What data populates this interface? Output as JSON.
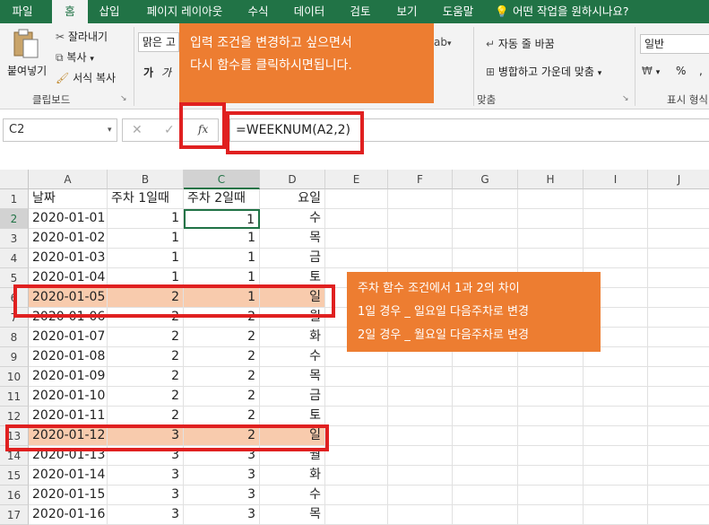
{
  "ribbon_tabs": [
    {
      "label": "파일"
    },
    {
      "label": "홈"
    },
    {
      "label": "삽입"
    },
    {
      "label": "페이지 레이아웃"
    },
    {
      "label": "수식"
    },
    {
      "label": "데이터"
    },
    {
      "label": "검토"
    },
    {
      "label": "보기"
    },
    {
      "label": "도움말"
    },
    {
      "label": "어떤 작업을 원하시나요?"
    }
  ],
  "clipboard": {
    "paste": "붙여넣기",
    "cut": "잘라내기",
    "copy": "복사",
    "format_painter": "서식 복사",
    "group": "클립보드"
  },
  "font": {
    "name": "맑은 고",
    "bold": "가",
    "italic": "가"
  },
  "alignment": {
    "wrap": "자동 줄 바꿈",
    "merge": "병합하고 가운데 맞춤",
    "group": "맞춤"
  },
  "number": {
    "format": "일반",
    "percent": "%",
    "comma": ",",
    "group": "표시 형식"
  },
  "formula_bar": {
    "name_box": "C2",
    "cancel": "✕",
    "enter": "✓",
    "fx": "fx",
    "formula": "=WEEKNUM(A2,2)"
  },
  "columns": [
    "A",
    "B",
    "C",
    "D",
    "E",
    "F",
    "G",
    "H",
    "I",
    "J"
  ],
  "rows": [
    {
      "n": "1",
      "a": "날짜",
      "b": "주차 1일때",
      "c": "주차 2일때",
      "d": "요일"
    },
    {
      "n": "2",
      "a": "2020-01-01",
      "b": "1",
      "c": "1",
      "d": "수"
    },
    {
      "n": "3",
      "a": "2020-01-02",
      "b": "1",
      "c": "1",
      "d": "목"
    },
    {
      "n": "4",
      "a": "2020-01-03",
      "b": "1",
      "c": "1",
      "d": "금"
    },
    {
      "n": "5",
      "a": "2020-01-04",
      "b": "1",
      "c": "1",
      "d": "토"
    },
    {
      "n": "6",
      "a": "2020-01-05",
      "b": "2",
      "c": "1",
      "d": "일"
    },
    {
      "n": "7",
      "a": "2020-01-06",
      "b": "2",
      "c": "2",
      "d": "월"
    },
    {
      "n": "8",
      "a": "2020-01-07",
      "b": "2",
      "c": "2",
      "d": "화"
    },
    {
      "n": "9",
      "a": "2020-01-08",
      "b": "2",
      "c": "2",
      "d": "수"
    },
    {
      "n": "10",
      "a": "2020-01-09",
      "b": "2",
      "c": "2",
      "d": "목"
    },
    {
      "n": "11",
      "a": "2020-01-10",
      "b": "2",
      "c": "2",
      "d": "금"
    },
    {
      "n": "12",
      "a": "2020-01-11",
      "b": "2",
      "c": "2",
      "d": "토"
    },
    {
      "n": "13",
      "a": "2020-01-12",
      "b": "3",
      "c": "2",
      "d": "일"
    },
    {
      "n": "14",
      "a": "2020-01-13",
      "b": "3",
      "c": "3",
      "d": "월"
    },
    {
      "n": "15",
      "a": "2020-01-14",
      "b": "3",
      "c": "3",
      "d": "화"
    },
    {
      "n": "16",
      "a": "2020-01-15",
      "b": "3",
      "c": "3",
      "d": "수"
    },
    {
      "n": "17",
      "a": "2020-01-16",
      "b": "3",
      "c": "3",
      "d": "목"
    }
  ],
  "callout_top": {
    "line1": "입력 조건을 변경하고 싶으면서",
    "line2": "다시 함수를 클릭하시면됩니다."
  },
  "callout_right": {
    "line1": "주차 함수 조건에서 1과 2의 차이",
    "line2": "1일 경우 _ 일요일 다음주차로 변경",
    "line3": "2일 경우 _ 월요일 다음주차로 변경"
  },
  "colors": {
    "excel_green": "#217346",
    "callout_orange": "#ed7d31",
    "highlight_red": "#e02020",
    "row_fill": "#f8cbad"
  }
}
